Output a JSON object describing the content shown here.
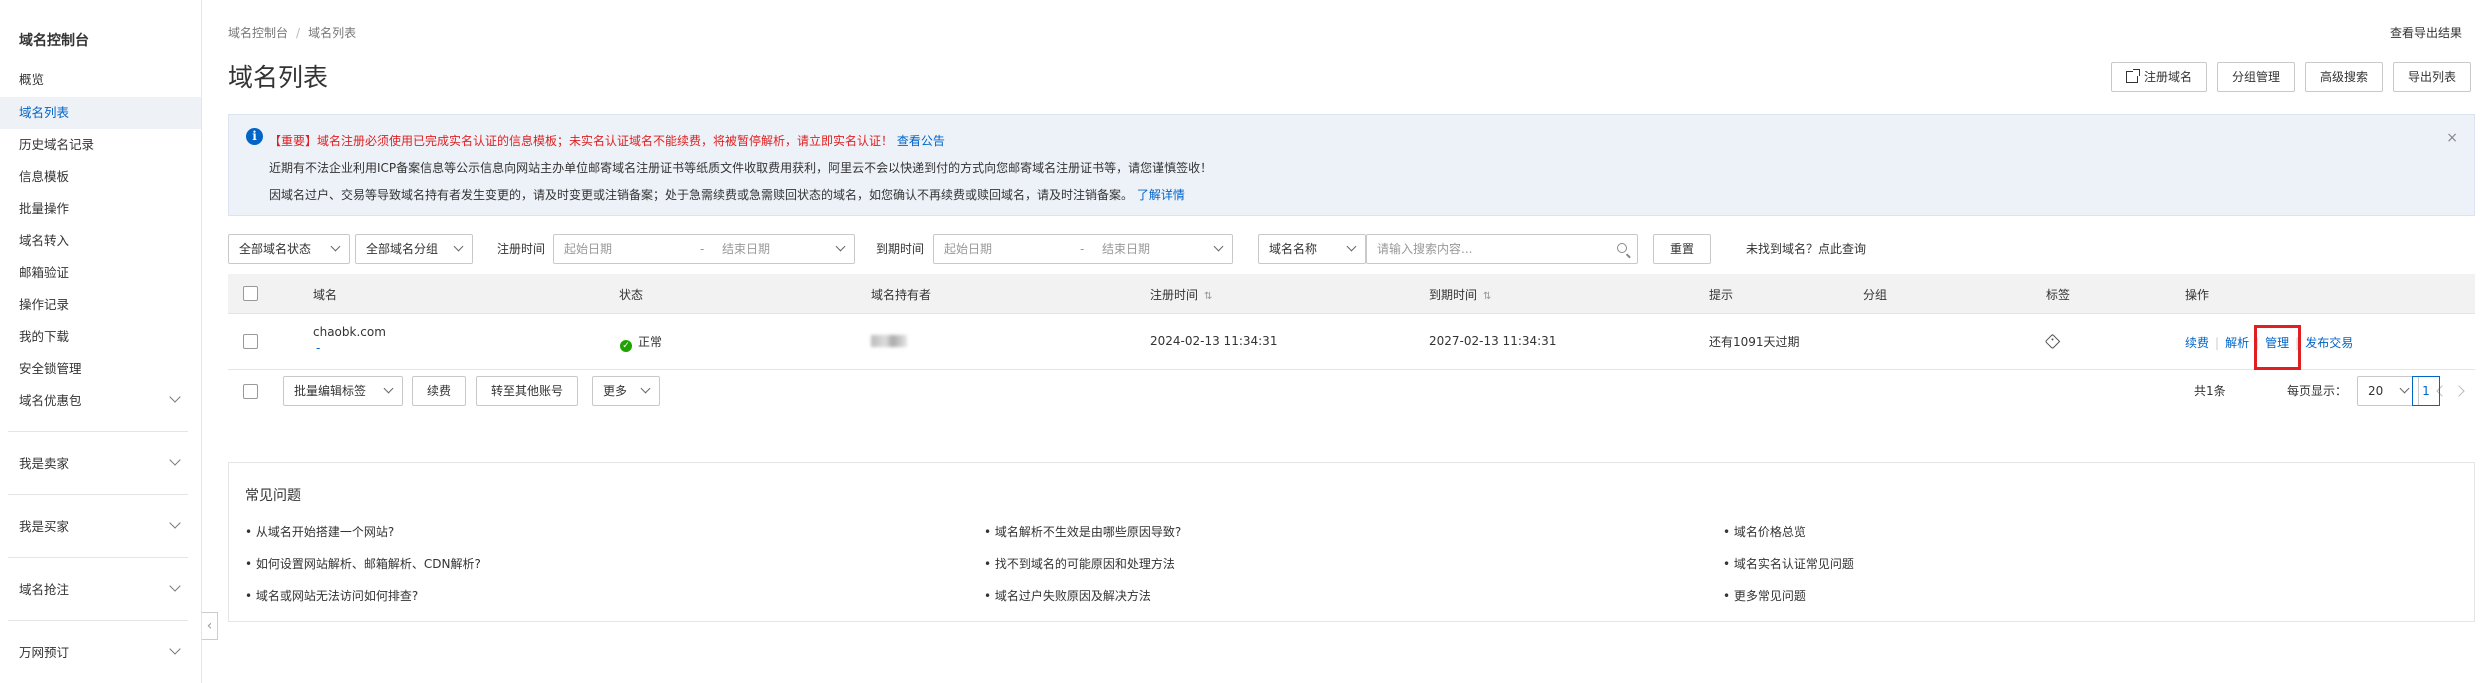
{
  "sidebar": {
    "title": "域名控制台",
    "items": [
      {
        "label": "概览"
      },
      {
        "label": "域名列表",
        "active": true
      },
      {
        "label": "历史域名记录"
      },
      {
        "label": "信息模板"
      },
      {
        "label": "批量操作"
      },
      {
        "label": "域名转入"
      },
      {
        "label": "邮箱验证"
      },
      {
        "label": "操作记录"
      },
      {
        "label": "我的下载"
      },
      {
        "label": "安全锁管理"
      },
      {
        "label": "域名优惠包"
      }
    ],
    "groups": [
      {
        "label": "我是卖家"
      },
      {
        "label": "我是买家"
      },
      {
        "label": "域名抢注"
      },
      {
        "label": "万网预订"
      }
    ]
  },
  "breadcrumb": {
    "root": "域名控制台",
    "sep": "/",
    "current": "域名列表"
  },
  "header": {
    "export_link": "查看导出结果",
    "title": "域名列表",
    "buttons": {
      "register": "注册域名",
      "group_manage": "分组管理",
      "advanced_search": "高级搜索",
      "export": "导出列表"
    }
  },
  "notice": {
    "line1_prefix": "【重要】域名注册必须使用已完成实名认证的信息模板；未实名认证域名不能续费，将被暂停解析，请立即实名认证！",
    "line1_link": "查看公告",
    "line2": "近期有不法企业利用ICP备案信息等公示信息向网站主办单位邮寄域名注册证书等纸质文件收取费用获利，阿里云不会以快递到付的方式向您邮寄域名注册证书等，请您谨慎签收！",
    "line3_prefix": "因域名过户、交易等导致域名持有者发生变更的，请及时变更或注销备案；处于急需续费或急需赎回状态的域名，如您确认不再续费或赎回域名，请及时注销备案。",
    "line3_link": "了解详情",
    "close": "×"
  },
  "filters": {
    "status": "全部域名状态",
    "group": "全部域名分组",
    "reg_time_label": "注册时间",
    "reg_start_placeholder": "起始日期",
    "reg_end_placeholder": "结束日期",
    "range_sep": "-",
    "exp_time_label": "到期时间",
    "exp_start_placeholder": "起始日期",
    "exp_end_placeholder": "结束日期",
    "search_field": "域名名称",
    "search_placeholder": "请输入搜索内容...",
    "reset": "重置",
    "not_found_link": "未找到域名？点此查询"
  },
  "table": {
    "headers": {
      "domain": "域名",
      "status": "状态",
      "holder": "域名持有者",
      "reg_time": "注册时间",
      "exp_time": "到期时间",
      "hint": "提示",
      "group": "分组",
      "tag": "标签",
      "ops": "操作",
      "sort": "⇅"
    },
    "rows": [
      {
        "domain": "chaobk.com",
        "sub": "-",
        "status": "正常",
        "reg_time": "2024-02-13 11:34:31",
        "exp_time": "2027-02-13 11:34:31",
        "hint": "还有1091天过期",
        "ops": {
          "renew": "续费",
          "resolve": "解析",
          "manage": "管理",
          "sell": "发布交易",
          "sep": "|"
        }
      }
    ]
  },
  "bulk": {
    "edit_tags": "批量编辑标签",
    "renew": "续费",
    "transfer": "转至其他账号",
    "more": "更多"
  },
  "pager": {
    "total": "共1条",
    "per_page_label": "每页显示：",
    "per_page": "20",
    "current": "1"
  },
  "faq": {
    "title": "常见问题",
    "items": [
      "• 从域名开始搭建一个网站?",
      "• 域名解析不生效是由哪些原因导致?",
      "• 域名价格总览",
      "• 如何设置网站解析、邮箱解析、CDN解析?",
      "• 找不到域名的可能原因和处理方法",
      "• 域名实名认证常见问题",
      "• 域名或网站无法访问如何排查?",
      "• 域名过户失败原因及解决方法",
      "• 更多常见问题"
    ]
  },
  "colors": {
    "accent": "#0064c8",
    "warning": "#e02020",
    "success": "#1fa300",
    "brand": "#ff6a00"
  }
}
